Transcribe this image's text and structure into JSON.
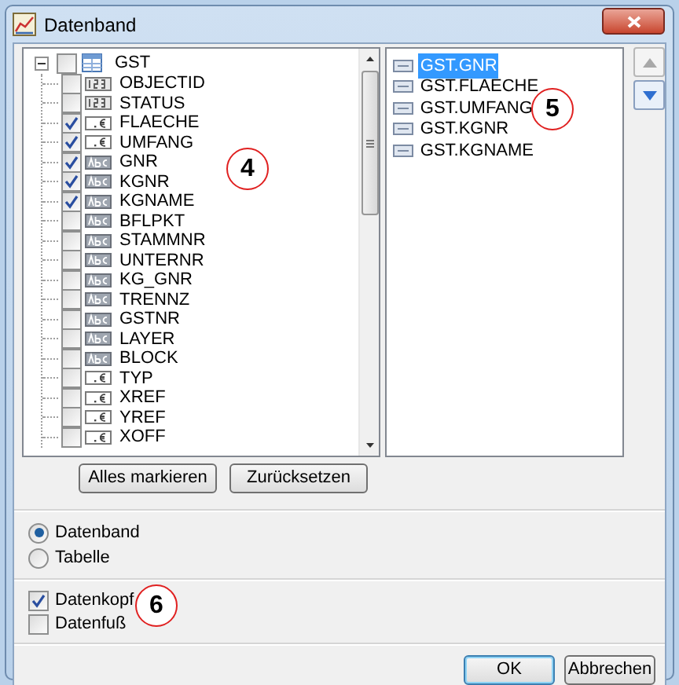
{
  "window": {
    "title": "Datenband"
  },
  "tree": {
    "label": "GST",
    "checked": false,
    "expanded": true,
    "children": [
      {
        "label": "OBJECTID",
        "kind": "number",
        "checked": false
      },
      {
        "label": "STATUS",
        "kind": "number",
        "checked": false
      },
      {
        "label": "FLAECHE",
        "kind": "decimal",
        "checked": true
      },
      {
        "label": "UMFANG",
        "kind": "decimal",
        "checked": true
      },
      {
        "label": "GNR",
        "kind": "text",
        "checked": true
      },
      {
        "label": "KGNR",
        "kind": "text",
        "checked": true
      },
      {
        "label": "KGNAME",
        "kind": "text",
        "checked": true
      },
      {
        "label": "BFLPKT",
        "kind": "text",
        "checked": false
      },
      {
        "label": "STAMMNR",
        "kind": "text",
        "checked": false
      },
      {
        "label": "UNTERNR",
        "kind": "text",
        "checked": false
      },
      {
        "label": "KG_GNR",
        "kind": "text",
        "checked": false
      },
      {
        "label": "TRENNZ",
        "kind": "text",
        "checked": false
      },
      {
        "label": "GSTNR",
        "kind": "text",
        "checked": false
      },
      {
        "label": "LAYER",
        "kind": "text",
        "checked": false
      },
      {
        "label": "BLOCK",
        "kind": "text",
        "checked": false
      },
      {
        "label": "TYP",
        "kind": "decimal",
        "checked": false
      },
      {
        "label": "XREF",
        "kind": "decimal",
        "checked": false
      },
      {
        "label": "YREF",
        "kind": "decimal",
        "checked": false
      },
      {
        "label": "XOFF",
        "kind": "decimal",
        "checked": false
      }
    ]
  },
  "selected_fields": [
    {
      "label": "GST.GNR",
      "selected": true
    },
    {
      "label": "GST.FLAECHE",
      "selected": false
    },
    {
      "label": "GST.UMFANG",
      "selected": false
    },
    {
      "label": "GST.KGNR",
      "selected": false
    },
    {
      "label": "GST.KGNAME",
      "selected": false
    }
  ],
  "tree_buttons": [
    "Alles markieren",
    "Zurücksetzen"
  ],
  "layout_options": [
    {
      "label": "Datenband",
      "selected": true
    },
    {
      "label": "Tabelle",
      "selected": false
    }
  ],
  "band_options": [
    {
      "label": "Datenkopf",
      "checked": true
    },
    {
      "label": "Datenfuß",
      "checked": false
    }
  ],
  "buttons": [
    {
      "label": "OK",
      "default": true
    },
    {
      "label": "Abbrechen",
      "default": false
    }
  ],
  "annotations": [
    "4",
    "5",
    "6"
  ]
}
